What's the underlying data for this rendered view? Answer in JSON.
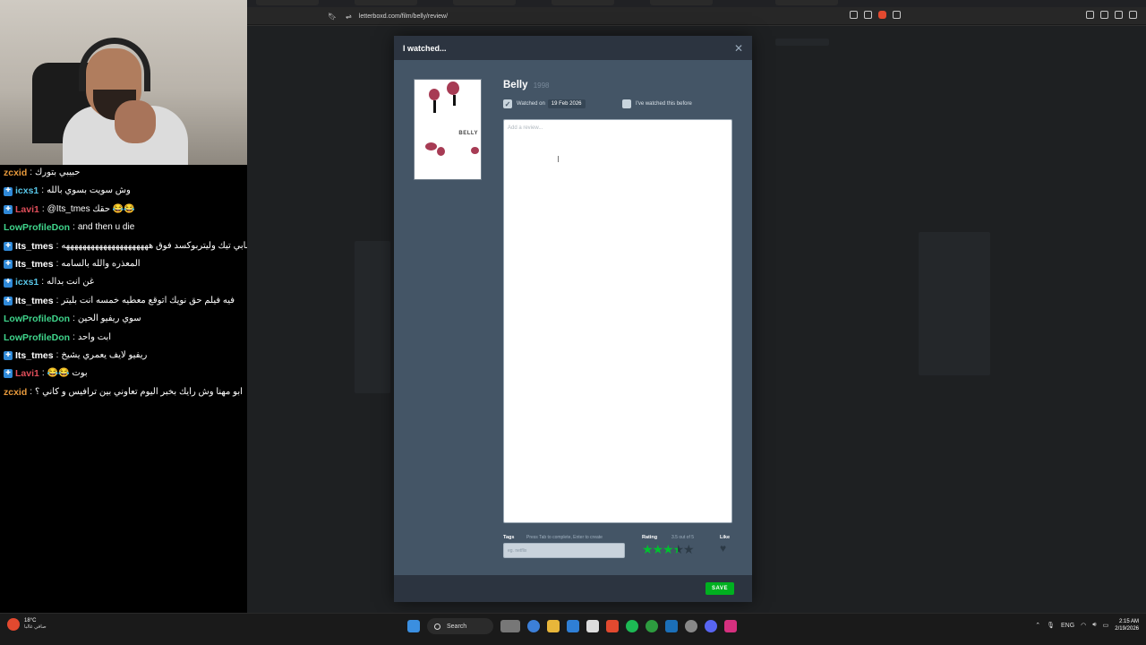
{
  "browser": {
    "url": "letterboxd.com/film/belly/review/"
  },
  "modal": {
    "title": "I watched...",
    "film_title": "Belly",
    "film_year": "1998",
    "poster_word": "BELLY",
    "watched_on_label": "Watched on",
    "watched_on_date": "19 Feb 2026",
    "watched_before_label": "I've watched this before",
    "review_placeholder": "Add a review...",
    "tags_label": "Tags",
    "tags_hint": "Press Tab to complete, Enter to create",
    "tags_placeholder": "eg. netflix",
    "rating_label": "Rating",
    "rating_value": "3.5 out of 5",
    "rating_stars": 3.5,
    "like_label": "Like",
    "save_label": "SAVE",
    "close_icon": "close-icon"
  },
  "chat": [
    {
      "user": "zcxid",
      "color": "#e89a3c",
      "badge": false,
      "message": "حبيبي بتورك"
    },
    {
      "user": "icxs1",
      "color": "#58c6e8",
      "badge": true,
      "message": "وش سويت بسوي بالله"
    },
    {
      "user": "Lavi1",
      "color": "#e04e5a",
      "badge": true,
      "message": "@Its_tmes حقك 😂😂"
    },
    {
      "user": "LowProfileDon",
      "color": "#3fd48b",
      "badge": false,
      "message": "and then u die"
    },
    {
      "user": "Its_tmes",
      "color": "#ffffff",
      "badge": true,
      "message": "قلت حسابي تيك وليتربوكسد فوق هههههههههههههههههههههه"
    },
    {
      "user": "Its_tmes",
      "color": "#ffffff",
      "badge": true,
      "message": "المعذره والله بالسامه"
    },
    {
      "user": "icxs1",
      "color": "#58c6e8",
      "badge": true,
      "message": "غن انت بداله"
    },
    {
      "user": "Its_tmes",
      "color": "#ffffff",
      "badge": true,
      "message": "فيه فيلم حق نويك اتوقع معطيه خمسه انت بليتر"
    },
    {
      "user": "LowProfileDon",
      "color": "#3fd48b",
      "badge": false,
      "message": "سوي ريفيو الحين"
    },
    {
      "user": "LowProfileDon",
      "color": "#3fd48b",
      "badge": false,
      "message": "ابت واحد"
    },
    {
      "user": "Its_tmes",
      "color": "#ffffff",
      "badge": true,
      "message": "ريفيو لايف يعمري يشيخ"
    },
    {
      "user": "Lavi1",
      "color": "#e04e5a",
      "badge": true,
      "message": "بوت 😂😂"
    },
    {
      "user": "zcxid",
      "color": "#e89a3c",
      "badge": false,
      "message": "ابو مهنا وش رايك بخبر اليوم تعاوني بين ترافيس و كاني ؟"
    }
  ],
  "taskbar": {
    "weather_temp": "18°C",
    "weather_cond": "صافي غالبا",
    "search_label": "Search",
    "lang": "ENG",
    "time": "2:15 AM",
    "date": "2/19/2026"
  }
}
